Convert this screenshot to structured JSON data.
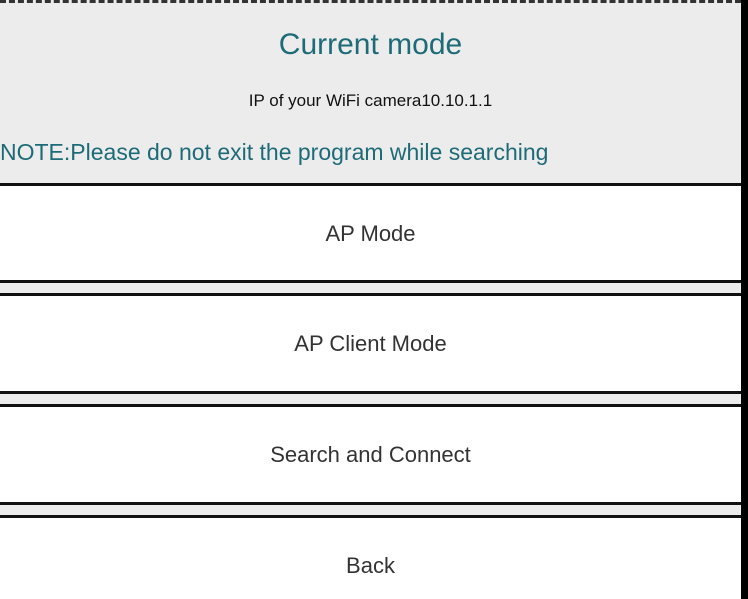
{
  "header": {
    "title": "Current mode",
    "ip_text": "IP of your WiFi camera10.10.1.1",
    "note": "NOTE:Please do not exit the program while searching"
  },
  "options": [
    {
      "label": "AP Mode"
    },
    {
      "label": "AP Client Mode"
    },
    {
      "label": "Search and Connect"
    },
    {
      "label": "Back"
    }
  ],
  "colors": {
    "accent": "#1e6b78",
    "background": "#ececec",
    "button_background": "#ffffff",
    "separator": "#111111"
  }
}
